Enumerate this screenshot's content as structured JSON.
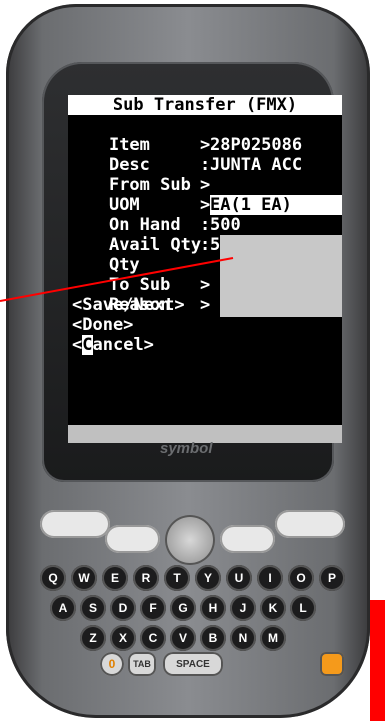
{
  "app": {
    "title": "Sub Transfer (FMX)",
    "brand": "symbol"
  },
  "fields": [
    {
      "label": "Item",
      "sep": ">",
      "value": "28P025086"
    },
    {
      "label": "Desc",
      "sep": ":",
      "value": "JUNTA ACC"
    },
    {
      "label": "From Sub",
      "sep": ">",
      "value": ""
    },
    {
      "label": "UOM",
      "sep": ">",
      "value": "EA(1 EA)"
    },
    {
      "label": "On Hand",
      "sep": ":",
      "value": "500"
    },
    {
      "label": "Avail Qty",
      "sep": ":",
      "value": "500"
    },
    {
      "label": "Qty",
      "sep": "",
      "value": ""
    },
    {
      "label": "To Sub",
      "sep": ">",
      "value": ""
    },
    {
      "label": "Reason",
      "sep": ">",
      "value": ""
    }
  ],
  "actions": {
    "save_next": "<Save/Next>",
    "done": "<Done>",
    "cancel_prefix": "<",
    "cancel_cursor": "C",
    "cancel_rest": "ancel>"
  },
  "keypad": {
    "row1": [
      "Q",
      "W",
      "E",
      "R",
      "T",
      "Y",
      "U",
      "I",
      "O",
      "P"
    ],
    "row2": [
      "A",
      "S",
      "D",
      "F",
      "G",
      "H",
      "J",
      "K",
      "L"
    ],
    "row3": [
      "Z",
      "X",
      "C",
      "V",
      "B",
      "N",
      "M"
    ],
    "space_label": "SPACE",
    "tab_label": "TAB",
    "zero_label": "0"
  },
  "colors": {
    "screen_bg": "#000000",
    "screen_text": "#ffffff",
    "input_bg": "#c8c8c8",
    "annotation_line": "#ff0000"
  }
}
